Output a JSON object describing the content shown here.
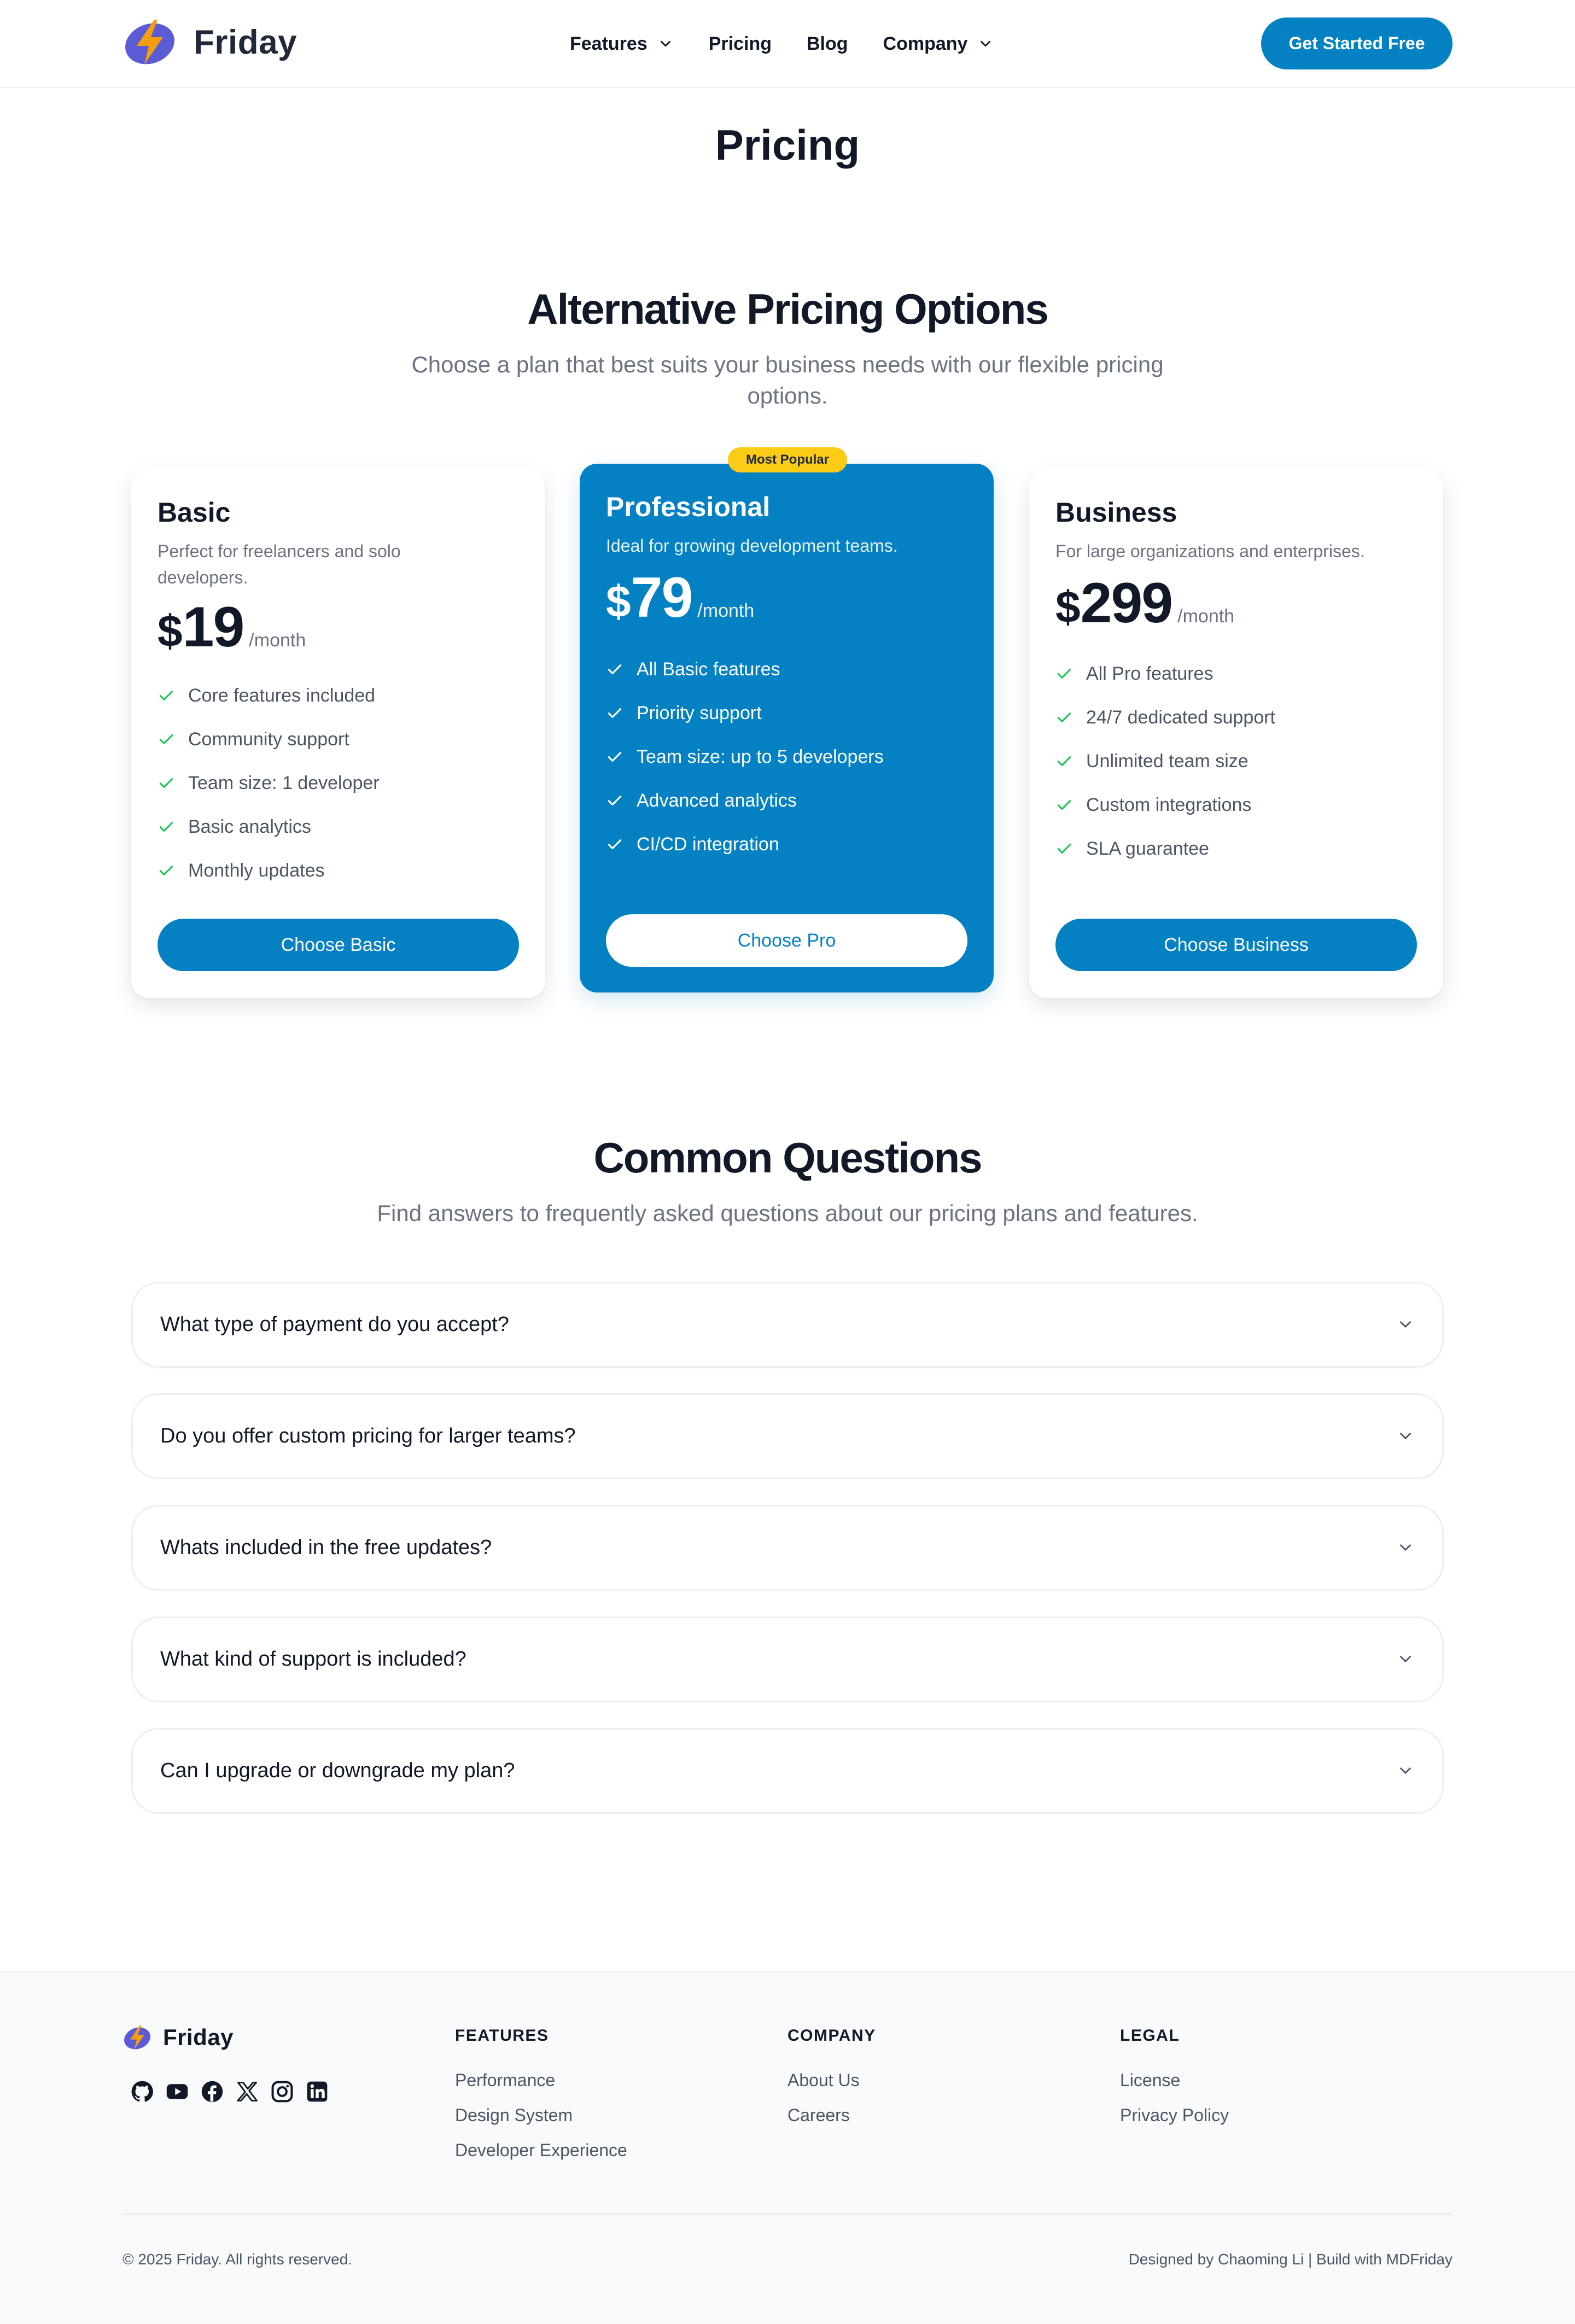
{
  "header": {
    "brand": "Friday",
    "nav": [
      {
        "label": "Features",
        "has_dropdown": true
      },
      {
        "label": "Pricing",
        "has_dropdown": false
      },
      {
        "label": "Blog",
        "has_dropdown": false
      },
      {
        "label": "Company",
        "has_dropdown": true
      }
    ],
    "cta": "Get Started Free"
  },
  "page_title": "Pricing",
  "pricing": {
    "title": "Alternative Pricing Options",
    "subtitle_line1": "Choose a plan that best suits your business needs with our flexible pricing",
    "subtitle_line2": "options.",
    "badge": "Most Popular",
    "plans": [
      {
        "name": "Basic",
        "description": "Perfect for freelancers and solo developers.",
        "currency": "$",
        "amount": "19",
        "period": "/month",
        "features": [
          "Core features included",
          "Community support",
          "Team size: 1 developer",
          "Basic analytics",
          "Monthly updates"
        ],
        "button": "Choose Basic"
      },
      {
        "name": "Professional",
        "description": "Ideal for growing development teams.",
        "currency": "$",
        "amount": "79",
        "period": "/month",
        "features": [
          "All Basic features",
          "Priority support",
          "Team size: up to 5 developers",
          "Advanced analytics",
          "CI/CD integration"
        ],
        "button": "Choose Pro"
      },
      {
        "name": "Business",
        "description": "For large organizations and enterprises.",
        "currency": "$",
        "amount": "299",
        "period": "/month",
        "features": [
          "All Pro features",
          "24/7 dedicated support",
          "Unlimited team size",
          "Custom integrations",
          "SLA guarantee"
        ],
        "button": "Choose Business"
      }
    ]
  },
  "faq": {
    "title": "Common Questions",
    "subtitle": "Find answers to frequently asked questions about our pricing plans and features.",
    "items": [
      "What type of payment do you accept?",
      "Do you offer custom pricing for larger teams?",
      "Whats included in the free updates?",
      "What kind of support is included?",
      "Can I upgrade or downgrade my plan?"
    ]
  },
  "footer": {
    "brand": "Friday",
    "socials": [
      "github-icon",
      "youtube-icon",
      "facebook-icon",
      "x-icon",
      "instagram-icon",
      "linkedin-icon"
    ],
    "columns": [
      {
        "heading": "FEATURES",
        "links": [
          "Performance",
          "Design System",
          "Developer Experience"
        ]
      },
      {
        "heading": "COMPANY",
        "links": [
          "About Us",
          "Careers"
        ]
      },
      {
        "heading": "LEGAL",
        "links": [
          "License",
          "Privacy Policy"
        ]
      }
    ],
    "copyright": "© 2025 Friday. All rights reserved.",
    "credit": "Designed by Chaoming Li | Build with MDFriday"
  },
  "colors": {
    "accent": "#0381c3",
    "badge": "#facc15",
    "check": "#22c55e",
    "text": "#111827",
    "muted": "#6b7280"
  }
}
